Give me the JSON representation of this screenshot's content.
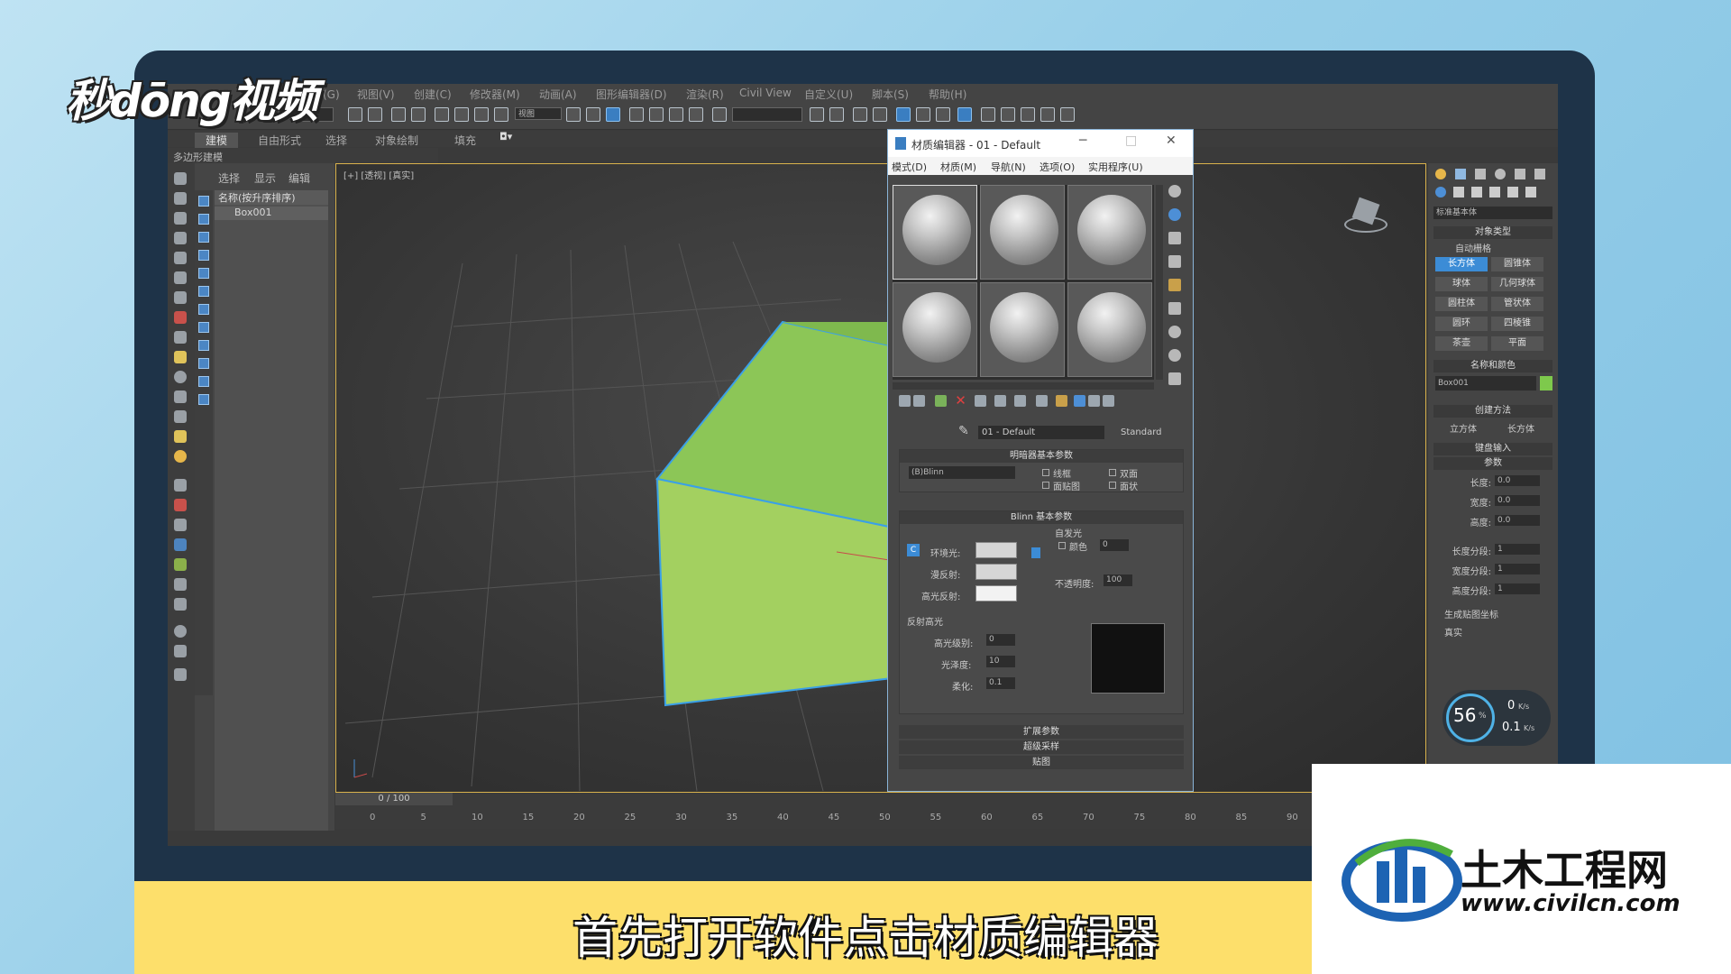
{
  "overlay": {
    "brand_logo": "秒dōng视频",
    "caption": "首先打开软件点击材质编辑器",
    "watermark_title": "土木工程网",
    "watermark_url": "www.civilcn.com"
  },
  "app": {
    "menus": [
      "组(G)",
      "视图(V)",
      "创建(C)",
      "修改器(M)",
      "动画(A)",
      "图形编辑器(D)",
      "渲染(R)",
      "Civil View",
      "自定义(U)",
      "脚本(S)",
      "帮助(H)"
    ],
    "toolbar_dropdown": "视图",
    "ribbon_tabs": [
      "建模",
      "自由形式",
      "选择",
      "对象绘制",
      "填充"
    ],
    "ribbon_sub": "多边形建模",
    "explorer_tabs": [
      "选择",
      "显示",
      "编辑"
    ],
    "explorer_header": "名称(按升序排序)",
    "explorer_item": "Box001",
    "viewport_label": "[+] [透视] [真实]",
    "time_slider": "0 / 100",
    "ticks": [
      "0",
      "5",
      "10",
      "15",
      "20",
      "25",
      "30",
      "35",
      "40",
      "45",
      "50",
      "55",
      "60",
      "65",
      "70",
      "75",
      "80",
      "85",
      "90"
    ]
  },
  "command_panel": {
    "category": "标准基本体",
    "rollout_object_type": "对象类型",
    "autogrid": "自动栅格",
    "buttons": [
      "长方体",
      "圆锥体",
      "球体",
      "几何球体",
      "圆柱体",
      "管状体",
      "圆环",
      "四棱锥",
      "茶壶",
      "平面"
    ],
    "rollout_name_color": "名称和颜色",
    "object_name": "Box001",
    "object_color": "#7ec94c",
    "rollout_creation": "创建方法",
    "creation_opt1": "立方体",
    "creation_opt2": "长方体",
    "rollout_keyboard": "键盘输入",
    "rollout_params": "参数",
    "params": [
      {
        "label": "长度:",
        "value": "0.0"
      },
      {
        "label": "宽度:",
        "value": "0.0"
      },
      {
        "label": "高度:",
        "value": "0.0"
      },
      {
        "label": "长度分段:",
        "value": "1"
      },
      {
        "label": "宽度分段:",
        "value": "1"
      },
      {
        "label": "高度分段:",
        "value": "1"
      }
    ],
    "gen_map_coords": "生成贴图坐标",
    "real_world": "真实"
  },
  "net_widget": {
    "percent": "56",
    "percent_unit": "%",
    "up": "0",
    "up_unit": "K/s",
    "down": "0.1",
    "down_unit": "K/s"
  },
  "material_editor": {
    "title": "材质编辑器 - 01 - Default",
    "menus": [
      "模式(D)",
      "材质(M)",
      "导航(N)",
      "选项(O)",
      "实用程序(U)"
    ],
    "material_name": "01 - Default",
    "material_type": "Standard",
    "shader_group": "明暗器基本参数",
    "shader": "(B)Blinn",
    "shader_checks": [
      "线框",
      "双面",
      "面贴图",
      "面状"
    ],
    "blinn_group": "Blinn 基本参数",
    "self_illum": "自发光",
    "self_illum_color": "颜色",
    "self_illum_value": "0",
    "ambient": "环境光:",
    "diffuse": "漫反射:",
    "specular": "高光反射:",
    "opacity_label": "不透明度:",
    "opacity": "100",
    "spec_highlights": "反射高光",
    "spec_level_label": "高光级别:",
    "spec_level": "0",
    "gloss_label": "光泽度:",
    "gloss": "10",
    "soften_label": "柔化:",
    "soften": "0.1",
    "rollouts": [
      "扩展参数",
      "超级采样",
      "贴图"
    ],
    "lock_label": "C"
  },
  "colors": {
    "box_green": "#8cc657",
    "selection": "#3aa0e8",
    "accent_blue": "#3c8cd6",
    "caption_band": "#fddf6b"
  }
}
